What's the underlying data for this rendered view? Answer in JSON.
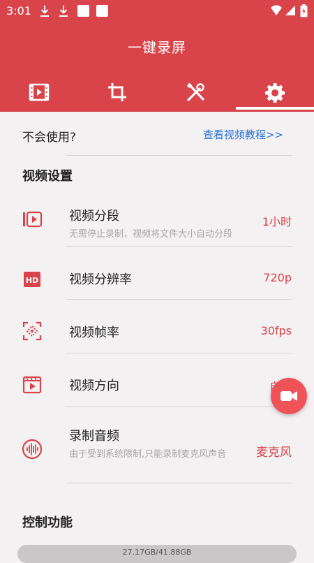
{
  "status_bar": {
    "time": "3:01",
    "icons": [
      "download-icon",
      "download-icon",
      "square-notification-icon",
      "square-notification-icon",
      "wifi-icon",
      "signal-icon",
      "battery-icon"
    ]
  },
  "header": {
    "title": "一键录屏",
    "accent_color": "#d9434a",
    "tabs": [
      {
        "icon": "video-list-icon",
        "selected": false
      },
      {
        "icon": "crop-icon",
        "selected": false
      },
      {
        "icon": "tools-icon",
        "selected": false
      },
      {
        "icon": "gear-icon",
        "selected": true
      }
    ]
  },
  "help": {
    "text": "不会使用?",
    "link": "查看视频教程>>"
  },
  "video_settings": {
    "section_title": "视频设置",
    "items": [
      {
        "icon": "video-segment-icon",
        "title": "视频分段",
        "subtitle": "无需停止录制，视频将文件大小自动分段",
        "value": "1小时"
      },
      {
        "icon": "hd-icon",
        "title": "视频分辨率",
        "subtitle": "",
        "value": "720p"
      },
      {
        "icon": "frame-rate-icon",
        "title": "视频帧率",
        "subtitle": "",
        "value": "30fps"
      },
      {
        "icon": "orientation-icon",
        "title": "视频方向",
        "subtitle": "",
        "value": "自动"
      },
      {
        "icon": "audio-icon",
        "title": "录制音频",
        "subtitle": "由于受到系统限制,只能录制麦克风声音",
        "value": "麦克风"
      }
    ]
  },
  "control_section": {
    "section_title": "控制功能"
  },
  "fab": {
    "icon": "video-camera-icon"
  },
  "storage": {
    "text": "27.17GB/41.88GB"
  }
}
